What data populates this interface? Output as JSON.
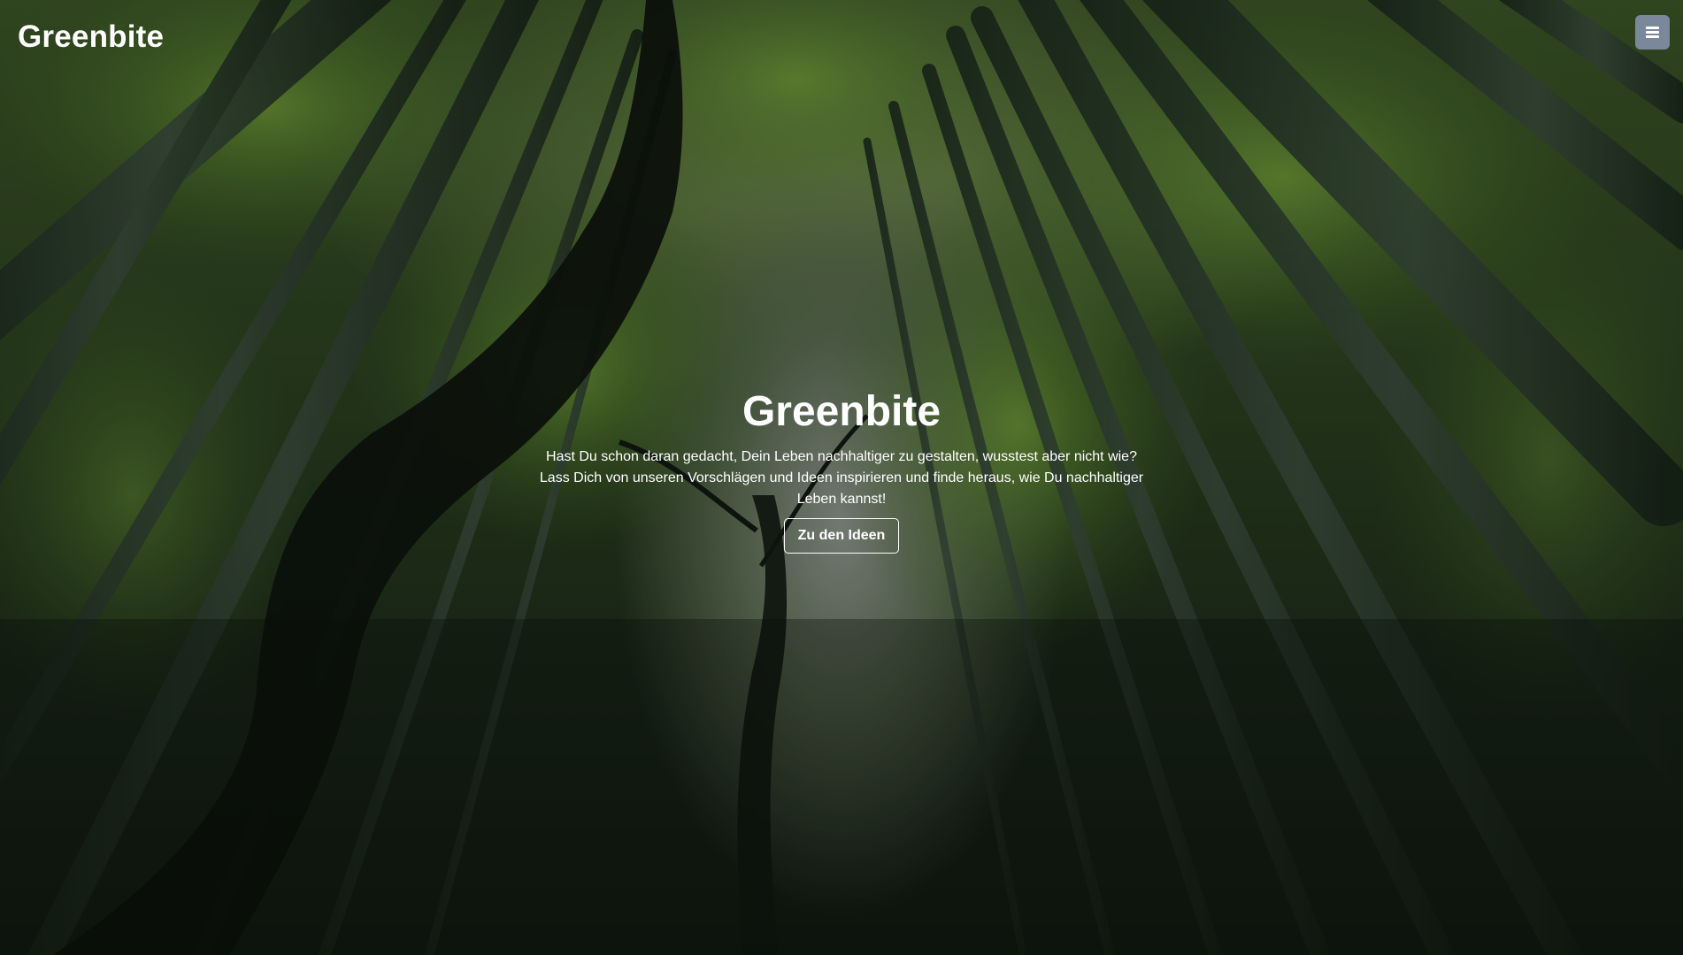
{
  "navbar": {
    "brand": "Greenbite",
    "menu_icon": "hamburger-menu-icon",
    "menu_color": "#7b879a"
  },
  "hero": {
    "title": "Greenbite",
    "lead": "Hast Du schon daran gedacht, Dein Leben nachhaltiger zu gestalten, wusstest aber nicht wie? Lass Dich von unseren Vorschlägen und Ideen inspirieren und finde heraus, wie Du nachhaltiger Leben kannst!",
    "cta_label": "Zu den Ideen"
  }
}
